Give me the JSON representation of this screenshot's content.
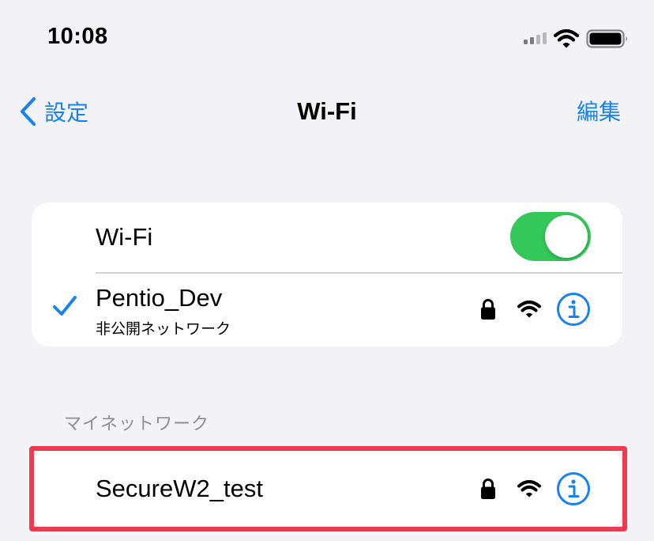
{
  "status_bar": {
    "time": "10:08",
    "icons": [
      "cellular-signal-icon",
      "wifi-icon",
      "battery-icon"
    ]
  },
  "nav": {
    "back_label": "設定",
    "title": "Wi-Fi",
    "edit_label": "編集"
  },
  "wifi_toggle": {
    "label": "Wi-Fi",
    "enabled": true
  },
  "connected_network": {
    "name": "Pentio_Dev",
    "subtitle": "非公開ネットワーク",
    "connected": true,
    "secured": true
  },
  "my_networks": {
    "header": "マイネットワーク",
    "items": [
      {
        "name": "SecureW2_test",
        "secured": true,
        "highlighted": true
      }
    ]
  },
  "colors": {
    "accent": "#1a82f0",
    "toggle_on": "#34c759",
    "highlight": "#ee3b4f",
    "background": "#f2f2f7"
  }
}
